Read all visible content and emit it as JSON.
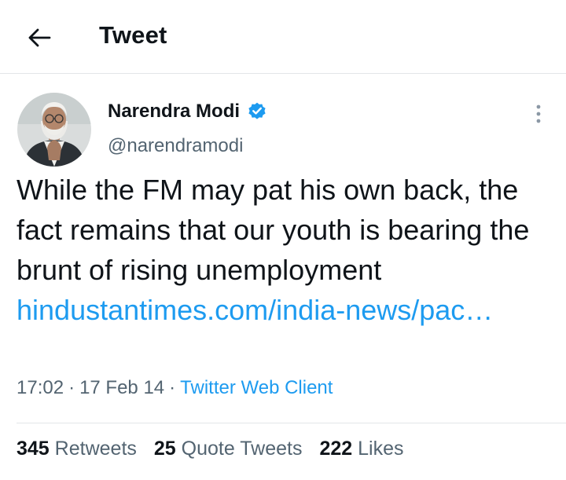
{
  "header": {
    "title": "Tweet",
    "back_icon": "arrow-left-icon"
  },
  "tweet": {
    "author_name": "Narendra Modi",
    "verified": true,
    "verified_color": "#1d9bf0",
    "handle": "@narendramodi",
    "text": "While the FM may pat his own back, the fact remains that our youth is bearing the brunt of rising unemployment",
    "link_text": "hindustantimes.com/india-news/pac…",
    "link_color": "#1d9bf0",
    "time": "17:02",
    "date": "17 Feb 14",
    "separator": "·",
    "client": "Twitter Web Client",
    "more_icon": "more-vertical-icon"
  },
  "stats": {
    "retweets_count": "345",
    "retweets_label": "Retweets",
    "quotes_count": "25",
    "quotes_label": "Quote Tweets",
    "likes_count": "222",
    "likes_label": "Likes"
  }
}
